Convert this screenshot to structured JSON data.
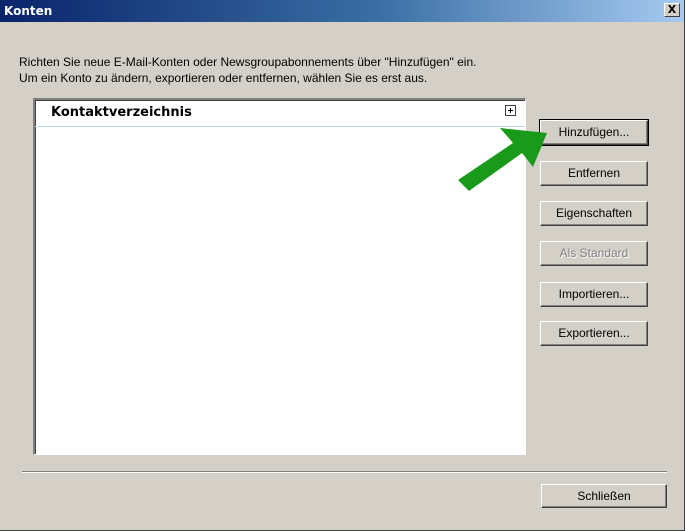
{
  "window": {
    "title": "Konten",
    "close_glyph": "X"
  },
  "instructions": {
    "line1": "Richten Sie neue E-Mail-Konten oder Newsgroupabonnements über \"Hinzufügen\" ein.",
    "line2": "Um ein Konto zu ändern, exportieren oder entfernen, wählen Sie es erst aus."
  },
  "list": {
    "header": "Kontaktverzeichnis",
    "expand_icon": "plus-box-icon"
  },
  "buttons": {
    "add": "Hinzufügen...",
    "remove": "Entfernen",
    "properties": "Eigenschaften",
    "set_default": "Als Standard",
    "import": "Importieren...",
    "export": "Exportieren...",
    "close": "Schließen"
  },
  "annotation": {
    "arrow_icon": "green-arrow-icon",
    "arrow_color": "#1a9a1a"
  }
}
